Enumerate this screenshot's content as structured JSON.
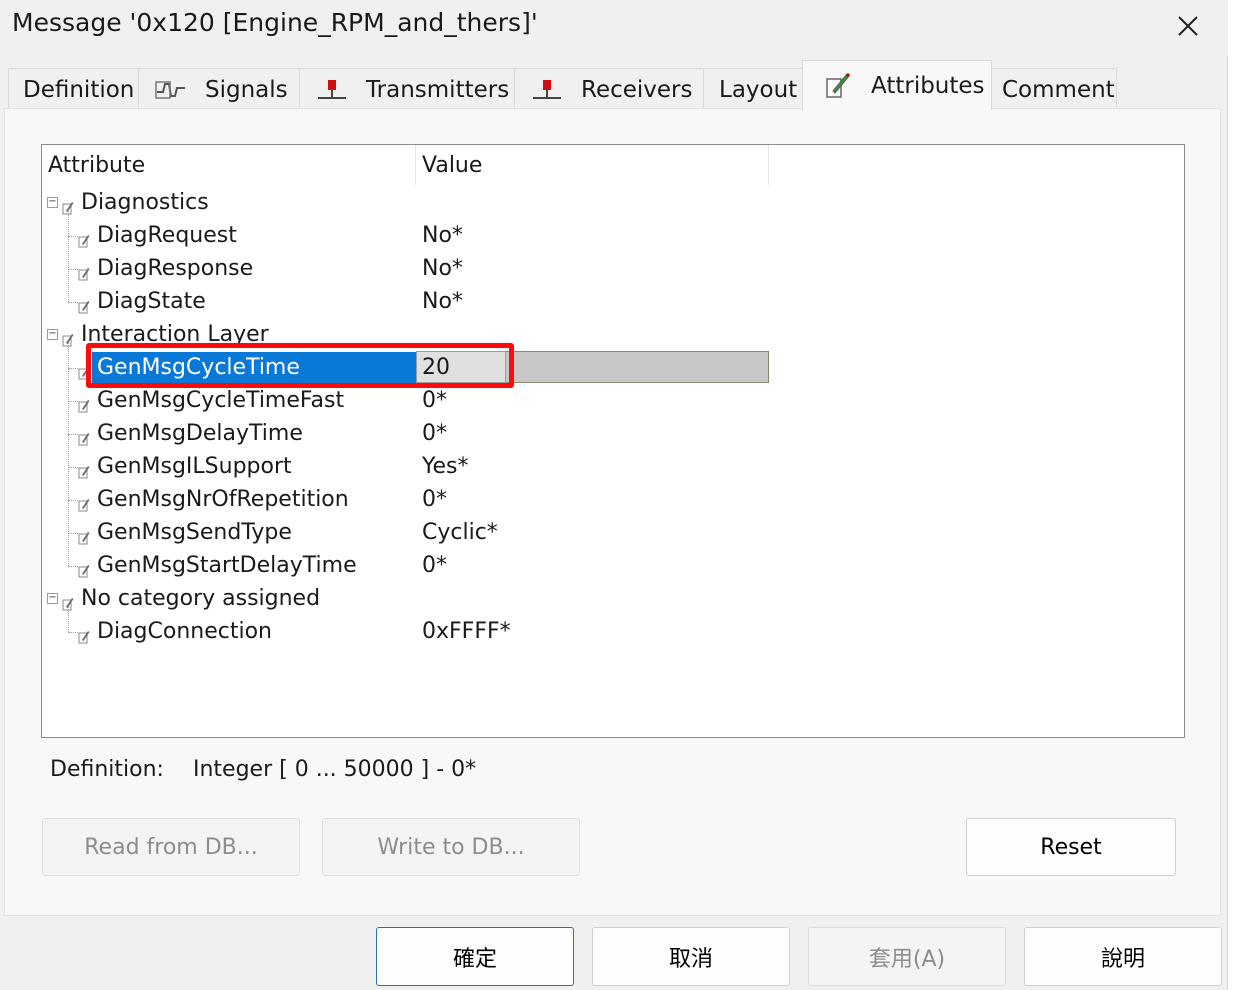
{
  "window": {
    "title": "Message '0x120 [Engine_RPM_and_thers]'",
    "close_icon": "close-icon"
  },
  "tabs": [
    {
      "label": "Definition",
      "icon": "",
      "active": false
    },
    {
      "label": "Signals",
      "icon": "signal-waveform-icon",
      "active": false
    },
    {
      "label": "Transmitters",
      "icon": "transmitter-icon",
      "active": false
    },
    {
      "label": "Receivers",
      "icon": "receiver-icon",
      "active": false
    },
    {
      "label": "Layout",
      "icon": "",
      "active": false
    },
    {
      "label": "Attributes",
      "icon": "attributes-pencil-icon",
      "active": true
    },
    {
      "label": "Comment",
      "icon": "",
      "active": false
    }
  ],
  "grid": {
    "columns": {
      "attribute": "Attribute",
      "value": "Value"
    },
    "rows": [
      {
        "name": "Diagnostics",
        "value": "",
        "level": 0,
        "expander": "⊟"
      },
      {
        "name": "DiagRequest",
        "value": "No*",
        "level": 1
      },
      {
        "name": "DiagResponse",
        "value": "No*",
        "level": 1
      },
      {
        "name": "DiagState",
        "value": "No*",
        "level": 1
      },
      {
        "name": "Interaction Layer",
        "value": "",
        "level": 0,
        "expander": "⊟"
      },
      {
        "name": "GenMsgCycleTime",
        "value": "20",
        "level": 1,
        "selected": true
      },
      {
        "name": "GenMsgCycleTimeFast",
        "value": "0*",
        "level": 1
      },
      {
        "name": "GenMsgDelayTime",
        "value": "0*",
        "level": 1
      },
      {
        "name": "GenMsgILSupport",
        "value": "Yes*",
        "level": 1
      },
      {
        "name": "GenMsgNrOfRepetition",
        "value": "0*",
        "level": 1
      },
      {
        "name": "GenMsgSendType",
        "value": "Cyclic*",
        "level": 1
      },
      {
        "name": "GenMsgStartDelayTime",
        "value": "0*",
        "level": 1
      },
      {
        "name": "No category assigned",
        "value": "",
        "level": 0,
        "expander": "⊟"
      },
      {
        "name": "DiagConnection",
        "value": "0xFFFF*",
        "level": 1
      }
    ]
  },
  "definition": {
    "label": "Definition:",
    "value": "Integer [ 0 ... 50000 ] - 0*"
  },
  "buttons": {
    "read_from_db": "Read from DB...",
    "write_to_db": "Write to DB...",
    "reset": "Reset",
    "ok": "確定",
    "cancel": "取消",
    "apply": "套用(A)",
    "help": "說明"
  },
  "colors": {
    "selection": "#0a78d7",
    "highlight_box": "#ff0a0a"
  }
}
